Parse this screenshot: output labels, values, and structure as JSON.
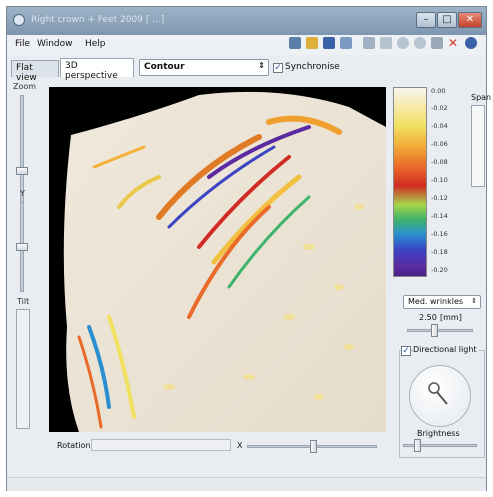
{
  "window": {
    "title": "Right crown + Feet 2009 [ ...]"
  },
  "menu": {
    "items": [
      "File",
      "Window",
      "Help"
    ]
  },
  "toolbar": {
    "icons": [
      "chart-icon",
      "open-folder-icon",
      "save-icon",
      "layers-icon",
      "anchor-icon",
      "export-icon",
      "shape-icon",
      "settings-icon",
      "pen-icon",
      "close-red-icon",
      "info-icon"
    ]
  },
  "view_tabs": [
    "Flat view",
    "3D perspective"
  ],
  "display_mode": {
    "selected": "Contour",
    "synchronise_label": "Synchronise",
    "synchronise_checked": true
  },
  "left_controls": {
    "zoom_label": "Zoom",
    "y_label": "Y",
    "tilt_label": "Tilt"
  },
  "legend": {
    "ticks": [
      "0.00",
      "-0.02",
      "-0.04",
      "-0.06",
      "-0.08",
      "-0.10",
      "-0.12",
      "-0.14",
      "-0.16",
      "-0.18",
      "-0.20"
    ],
    "span_label": "Span",
    "colors": [
      "#f8f6f2",
      "#f2e060",
      "#f2b13a",
      "#ea6a2a",
      "#d12c24",
      "#a6d44a",
      "#3fb36c",
      "#2a8fd0",
      "#3b44c4",
      "#4a1f8a"
    ]
  },
  "filter": {
    "selected": "Med. wrinkles",
    "value": "2.50",
    "unit": "[mm]"
  },
  "lighting": {
    "directional_label": "Directional light",
    "directional_checked": true,
    "brightness_label": "Brightness"
  },
  "bottom_controls": {
    "rotation_label": "Rotation",
    "x_label": "X"
  }
}
